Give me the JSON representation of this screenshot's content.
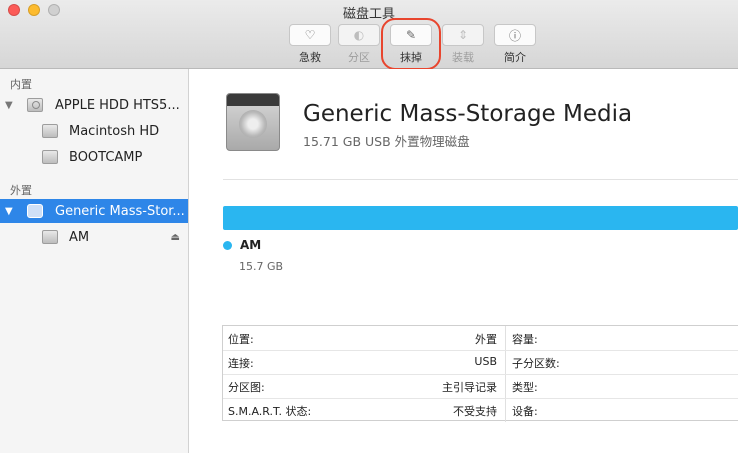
{
  "window": {
    "title": "磁盘工具"
  },
  "toolbar": {
    "items": [
      {
        "label": "急救",
        "icon": "stethoscope-icon",
        "glyph": "♡",
        "enabled": true
      },
      {
        "label": "分区",
        "icon": "partition-icon",
        "glyph": "◐",
        "enabled": false
      },
      {
        "label": "抹掉",
        "icon": "erase-icon",
        "glyph": "✎",
        "enabled": true
      },
      {
        "label": "装载",
        "icon": "mount-icon",
        "glyph": "⇕",
        "enabled": false
      },
      {
        "label": "简介",
        "icon": "info-icon",
        "glyph": "ⓘ",
        "enabled": true
      }
    ]
  },
  "sidebar": {
    "internal_label": "内置",
    "external_label": "外置",
    "internal": [
      {
        "label": "APPLE HDD HTS5...",
        "level": 0
      },
      {
        "label": "Macintosh HD",
        "level": 1
      },
      {
        "label": "BOOTCAMP",
        "level": 1
      }
    ],
    "external": [
      {
        "label": "Generic Mass-Stor...",
        "level": 0,
        "selected": true
      },
      {
        "label": "AM",
        "level": 1
      }
    ]
  },
  "device": {
    "name": "Generic Mass-Storage Media",
    "subtitle": "15.71 GB USB 外置物理磁盘",
    "partition_name": "AM",
    "partition_size": "15.7 GB",
    "usage_color": "#2ab6f0"
  },
  "info": {
    "rows": [
      {
        "k1": "位置:",
        "v1": "外置",
        "k2": "容量:"
      },
      {
        "k1": "连接:",
        "v1": "USB",
        "k2": "子分区数:"
      },
      {
        "k1": "分区图:",
        "v1": "主引导记录",
        "k2": "类型:"
      },
      {
        "k1": "S.M.A.R.T. 状态:",
        "v1": "不受支持",
        "k2": "设备:"
      }
    ]
  }
}
